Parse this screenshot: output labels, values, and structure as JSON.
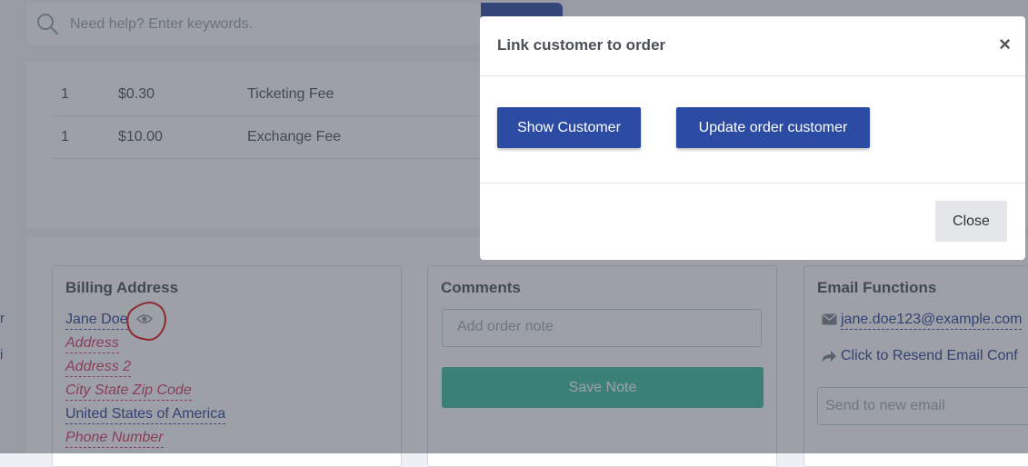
{
  "search": {
    "placeholder": "Need help? Enter keywords."
  },
  "fees": [
    {
      "qty": "1",
      "amount": "$0.30",
      "name": "Ticketing Fee"
    },
    {
      "qty": "1",
      "amount": "$10.00",
      "name": "Exchange Fee"
    }
  ],
  "billing": {
    "title": "Billing Address",
    "name": "Jane Doe",
    "address": "Address",
    "address2": "Address 2",
    "city": "City State Zip Code",
    "country": "United States of America",
    "phone": "Phone Number"
  },
  "comments": {
    "title": "Comments",
    "placeholder": "Add order note",
    "save_label": "Save Note"
  },
  "email_functions": {
    "title": "Email Functions",
    "email": "jane.doe123@example.com",
    "resend": "Click to Resend Email Conf",
    "send_placeholder": "Send to new email"
  },
  "left_edge_fragments": [
    "r",
    "i"
  ],
  "modal": {
    "title": "Link customer to order",
    "close_glyph": "×",
    "show_customer_label": "Show Customer",
    "update_customer_label": "Update order customer",
    "close_label": "Close"
  },
  "colors": {
    "primary": "#2c4ba3",
    "success": "#3bbf9f",
    "danger_text": "#d63a6b",
    "annotation": "#e01010"
  }
}
